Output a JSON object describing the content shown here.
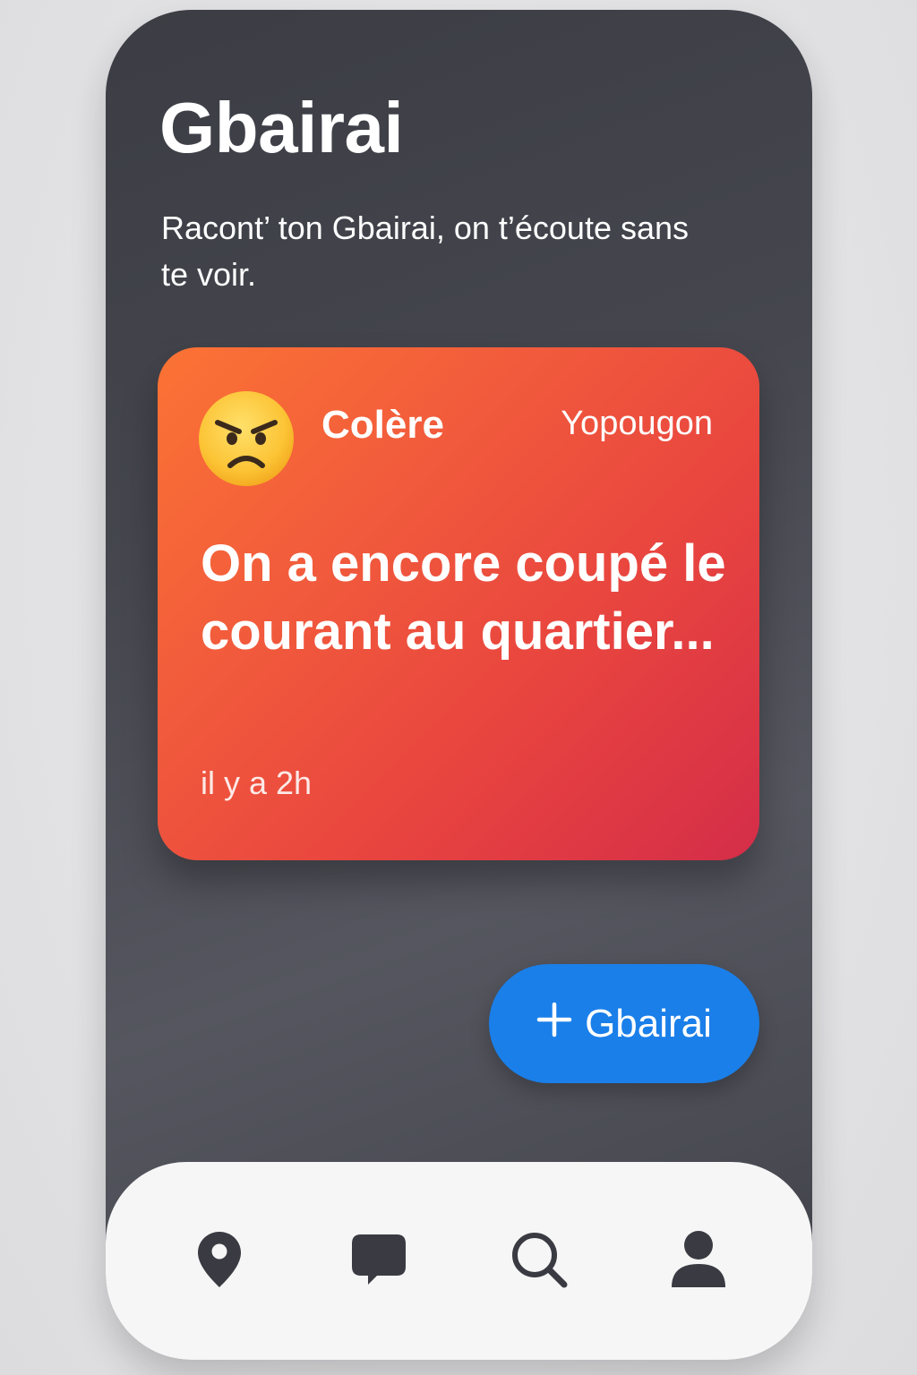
{
  "app": {
    "title": "Gbairai",
    "subtitle": "Racont’ ton Gbairai, on t’écoute sans te voir."
  },
  "post": {
    "emoji_icon": "angry-face-icon",
    "mood": "Colère",
    "location": "Yopougon",
    "text": "On a encore coupé le courant au quartier...",
    "time": "il y a 2h",
    "gradient_colors": [
      "#fb7334",
      "#d42d49"
    ]
  },
  "fab": {
    "icon": "plus-icon",
    "label": "Gbairai",
    "color": "#1a7fe9"
  },
  "bottom_nav": {
    "items": [
      {
        "icon": "map-pin-icon"
      },
      {
        "icon": "chat-bubble-icon"
      },
      {
        "icon": "search-icon"
      },
      {
        "icon": "profile-icon"
      }
    ],
    "icon_color": "#3a3b42"
  },
  "colors": {
    "background": "#45464e",
    "nav_background": "#f6f6f6"
  }
}
